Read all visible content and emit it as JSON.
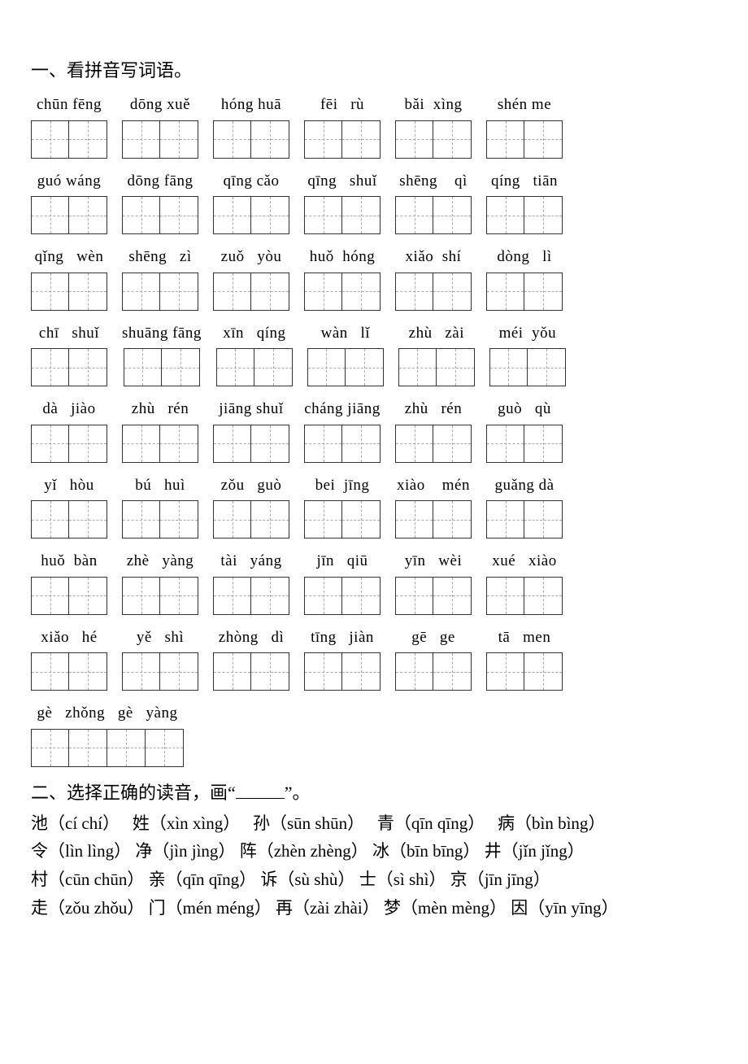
{
  "section1": {
    "heading": "一、看拼音写词语。",
    "rows": [
      [
        {
          "pinyin": "chūn fēng",
          "cells": 2
        },
        {
          "pinyin": "dōng xuě",
          "cells": 2
        },
        {
          "pinyin": "hóng huā",
          "cells": 2
        },
        {
          "pinyin": "fēi   rù",
          "cells": 2
        },
        {
          "pinyin": "bǎi  xìng",
          "cells": 2
        },
        {
          "pinyin": "shén me",
          "cells": 2
        }
      ],
      [
        {
          "pinyin": "guó wáng",
          "cells": 2
        },
        {
          "pinyin": "dōng fāng",
          "cells": 2
        },
        {
          "pinyin": "qīng cǎo",
          "cells": 2
        },
        {
          "pinyin": "qīng   shuǐ",
          "cells": 2
        },
        {
          "pinyin": "shēng    qì",
          "cells": 2
        },
        {
          "pinyin": "qíng   tiān",
          "cells": 2
        }
      ],
      [
        {
          "pinyin": "qǐng   wèn",
          "cells": 2
        },
        {
          "pinyin": "shēng   zì",
          "cells": 2
        },
        {
          "pinyin": "zuǒ   yòu",
          "cells": 2
        },
        {
          "pinyin": "huǒ  hóng",
          "cells": 2
        },
        {
          "pinyin": "xiǎo  shí",
          "cells": 2
        },
        {
          "pinyin": "dòng   lì",
          "cells": 2
        }
      ],
      [
        {
          "pinyin": "chī   shuǐ",
          "cells": 2
        },
        {
          "pinyin": "shuāng fāng",
          "cells": 2
        },
        {
          "pinyin": "xīn   qíng",
          "cells": 2
        },
        {
          "pinyin": "wàn   lǐ",
          "cells": 2
        },
        {
          "pinyin": "zhù   zài",
          "cells": 2
        },
        {
          "pinyin": "méi  yǒu",
          "cells": 2
        }
      ],
      [
        {
          "pinyin": "dà   jiào",
          "cells": 2
        },
        {
          "pinyin": "zhù   rén",
          "cells": 2
        },
        {
          "pinyin": "jiāng shuǐ",
          "cells": 2
        },
        {
          "pinyin": "cháng jiāng",
          "cells": 2
        },
        {
          "pinyin": "zhù   rén",
          "cells": 2
        },
        {
          "pinyin": "guò   qù",
          "cells": 2
        }
      ],
      [
        {
          "pinyin": "yǐ   hòu",
          "cells": 2
        },
        {
          "pinyin": "bú   huì",
          "cells": 2
        },
        {
          "pinyin": "zǒu   guò",
          "cells": 2
        },
        {
          "pinyin": "bei  jīng",
          "cells": 2
        },
        {
          "pinyin": "xiào    mén",
          "cells": 2
        },
        {
          "pinyin": "guǎng dà",
          "cells": 2
        }
      ],
      [
        {
          "pinyin": "huǒ  bàn",
          "cells": 2
        },
        {
          "pinyin": "zhè   yàng",
          "cells": 2
        },
        {
          "pinyin": "tài   yáng",
          "cells": 2
        },
        {
          "pinyin": "jīn   qiū",
          "cells": 2
        },
        {
          "pinyin": "yīn   wèi",
          "cells": 2
        },
        {
          "pinyin": "xué   xiào",
          "cells": 2
        }
      ],
      [
        {
          "pinyin": "xiǎo   hé",
          "cells": 2
        },
        {
          "pinyin": "yě   shì",
          "cells": 2
        },
        {
          "pinyin": "zhòng   dì",
          "cells": 2
        },
        {
          "pinyin": "tīng   jiàn",
          "cells": 2
        },
        {
          "pinyin": "gē   ge",
          "cells": 2
        },
        {
          "pinyin": "tā   men",
          "cells": 2
        }
      ],
      [
        {
          "pinyin": "gè   zhǒng   gè   yàng",
          "cells": 4
        }
      ]
    ]
  },
  "section2": {
    "heading_pre": "二、选择正确的读音，画“",
    "heading_post": "”。",
    "lines": [
      [
        {
          "han": "池",
          "py": "cí   chí"
        },
        {
          "han": "姓",
          "py": "xìn  xìng"
        },
        {
          "han": "孙",
          "py": "sūn   shūn"
        },
        {
          "han": "青",
          "py": "qīn   qīng"
        },
        {
          "han": "病",
          "py": "bìn bìng"
        }
      ],
      [
        {
          "han": "令",
          "py": "lìn   lìng"
        },
        {
          "han": "净",
          "py": "jìn   jìng"
        },
        {
          "han": "阵",
          "py": "zhèn zhèng"
        },
        {
          "han": "冰",
          "py": "bīn   bīng"
        },
        {
          "han": "井",
          "py": "jǐn jǐng"
        }
      ],
      [
        {
          "han": "村",
          "py": "cūn chūn"
        },
        {
          "han": "亲",
          "py": "qīn qīng"
        },
        {
          "han": "诉",
          "py": "sù   shù"
        },
        {
          "han": "士",
          "py": "sì  shì"
        },
        {
          "han": "京",
          "py": "jīn jīng"
        }
      ],
      [
        {
          "han": "走",
          "py": "zǒu zhǒu"
        },
        {
          "han": "门",
          "py": "mén méng"
        },
        {
          "han": "再",
          "py": "zài zhài"
        },
        {
          "han": "梦",
          "py": "mèn mèng"
        },
        {
          "han": "因",
          "py": "yīn yīng"
        }
      ]
    ]
  }
}
